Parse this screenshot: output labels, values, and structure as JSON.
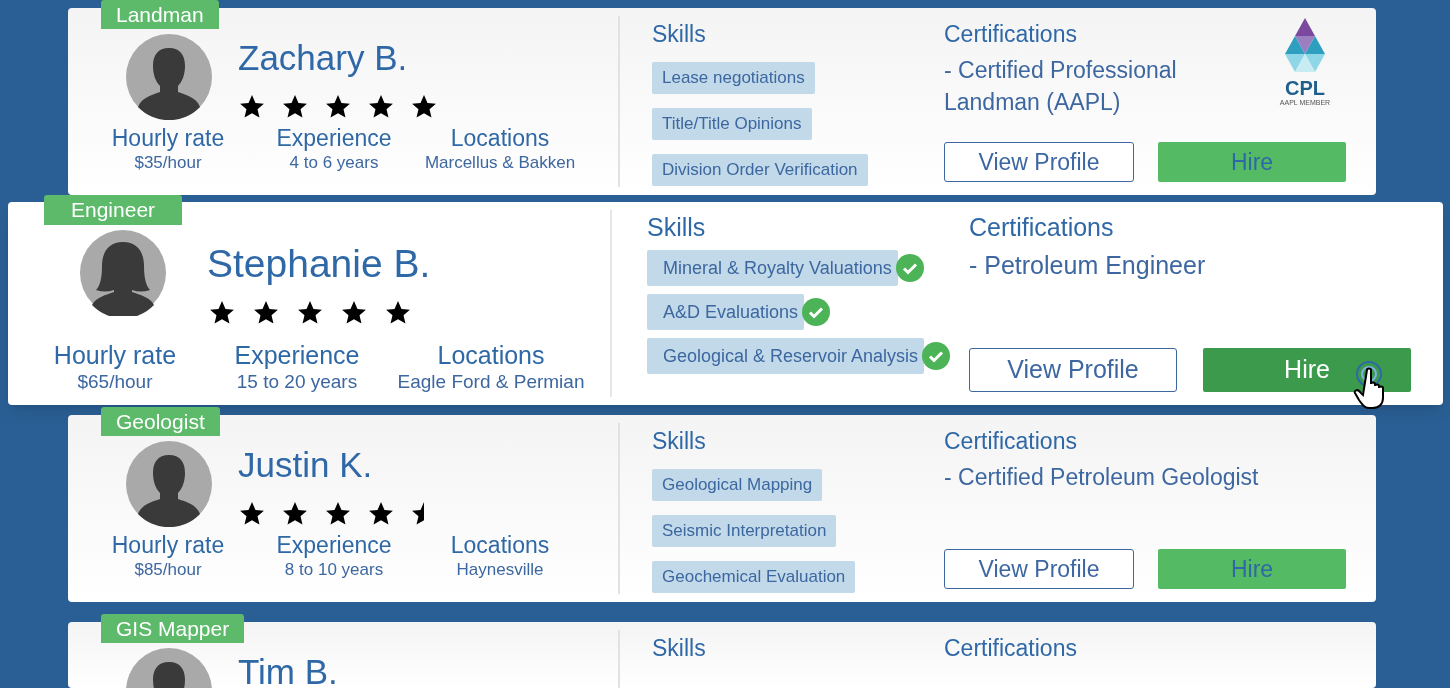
{
  "cards": [
    {
      "role": "Landman",
      "highlighted": false,
      "avatar": {
        "kind": "male"
      },
      "name": "Zachary B.",
      "stars": 5,
      "stats": [
        {
          "label": "Hourly rate",
          "value": "$35/hour"
        },
        {
          "label": "Experience",
          "value": "4 to 6 years"
        },
        {
          "label": "Locations",
          "value": "Marcellus & Bakken"
        }
      ],
      "skills_heading": "Skills",
      "skills": [
        {
          "label": "Lease negotiations",
          "verified": false
        },
        {
          "label": "Title/Title Opinions",
          "verified": false
        },
        {
          "label": "Division Order Verification",
          "verified": false
        }
      ],
      "certifications_heading": "Certifications",
      "certifications": [
        "- Certified Professional Landman (AAPL)"
      ],
      "badge": {
        "title": "CPL",
        "subtitle": "AAPL MEMBER"
      },
      "view_button": "View Profile",
      "hire_button": "Hire",
      "hire_hovered": false
    },
    {
      "role": "Engineer",
      "highlighted": true,
      "avatar": {
        "kind": "female"
      },
      "name": "Stephanie B.",
      "stars": 5,
      "stats": [
        {
          "label": "Hourly rate",
          "value": "$65/hour"
        },
        {
          "label": "Experience",
          "value": "15 to 20 years"
        },
        {
          "label": "Locations",
          "value": "Eagle Ford & Permian"
        }
      ],
      "skills_heading": "Skills",
      "skills": [
        {
          "label": "Mineral & Royalty Valuations",
          "verified": true
        },
        {
          "label": "A&D Evaluations",
          "verified": true
        },
        {
          "label": "Geological & Reservoir Analysis",
          "verified": true
        }
      ],
      "certifications_heading": "Certifications",
      "certifications": [
        "- Petroleum Engineer"
      ],
      "view_button": "View Profile",
      "hire_button": "Hire",
      "hire_hovered": true
    },
    {
      "role": "Geologist",
      "highlighted": false,
      "avatar": {
        "kind": "male"
      },
      "name": "Justin K.",
      "stars": 4.5,
      "stats": [
        {
          "label": "Hourly rate",
          "value": "$85/hour"
        },
        {
          "label": "Experience",
          "value": "8 to 10 years"
        },
        {
          "label": "Locations",
          "value": "Haynesville"
        }
      ],
      "skills_heading": "Skills",
      "skills": [
        {
          "label": "Geological Mapping",
          "verified": false
        },
        {
          "label": "Seismic Interpretation",
          "verified": false
        },
        {
          "label": "Geochemical Evaluation",
          "verified": false
        }
      ],
      "certifications_heading": "Certifications",
      "certifications": [
        "- Certified Petroleum Geologist"
      ],
      "view_button": "View Profile",
      "hire_button": "Hire",
      "hire_hovered": false
    },
    {
      "role": "GIS Mapper",
      "highlighted": false,
      "avatar": {
        "kind": "male"
      },
      "name": "Tim B.",
      "skills_heading": "Skills",
      "certifications_heading": "Certifications"
    }
  ]
}
